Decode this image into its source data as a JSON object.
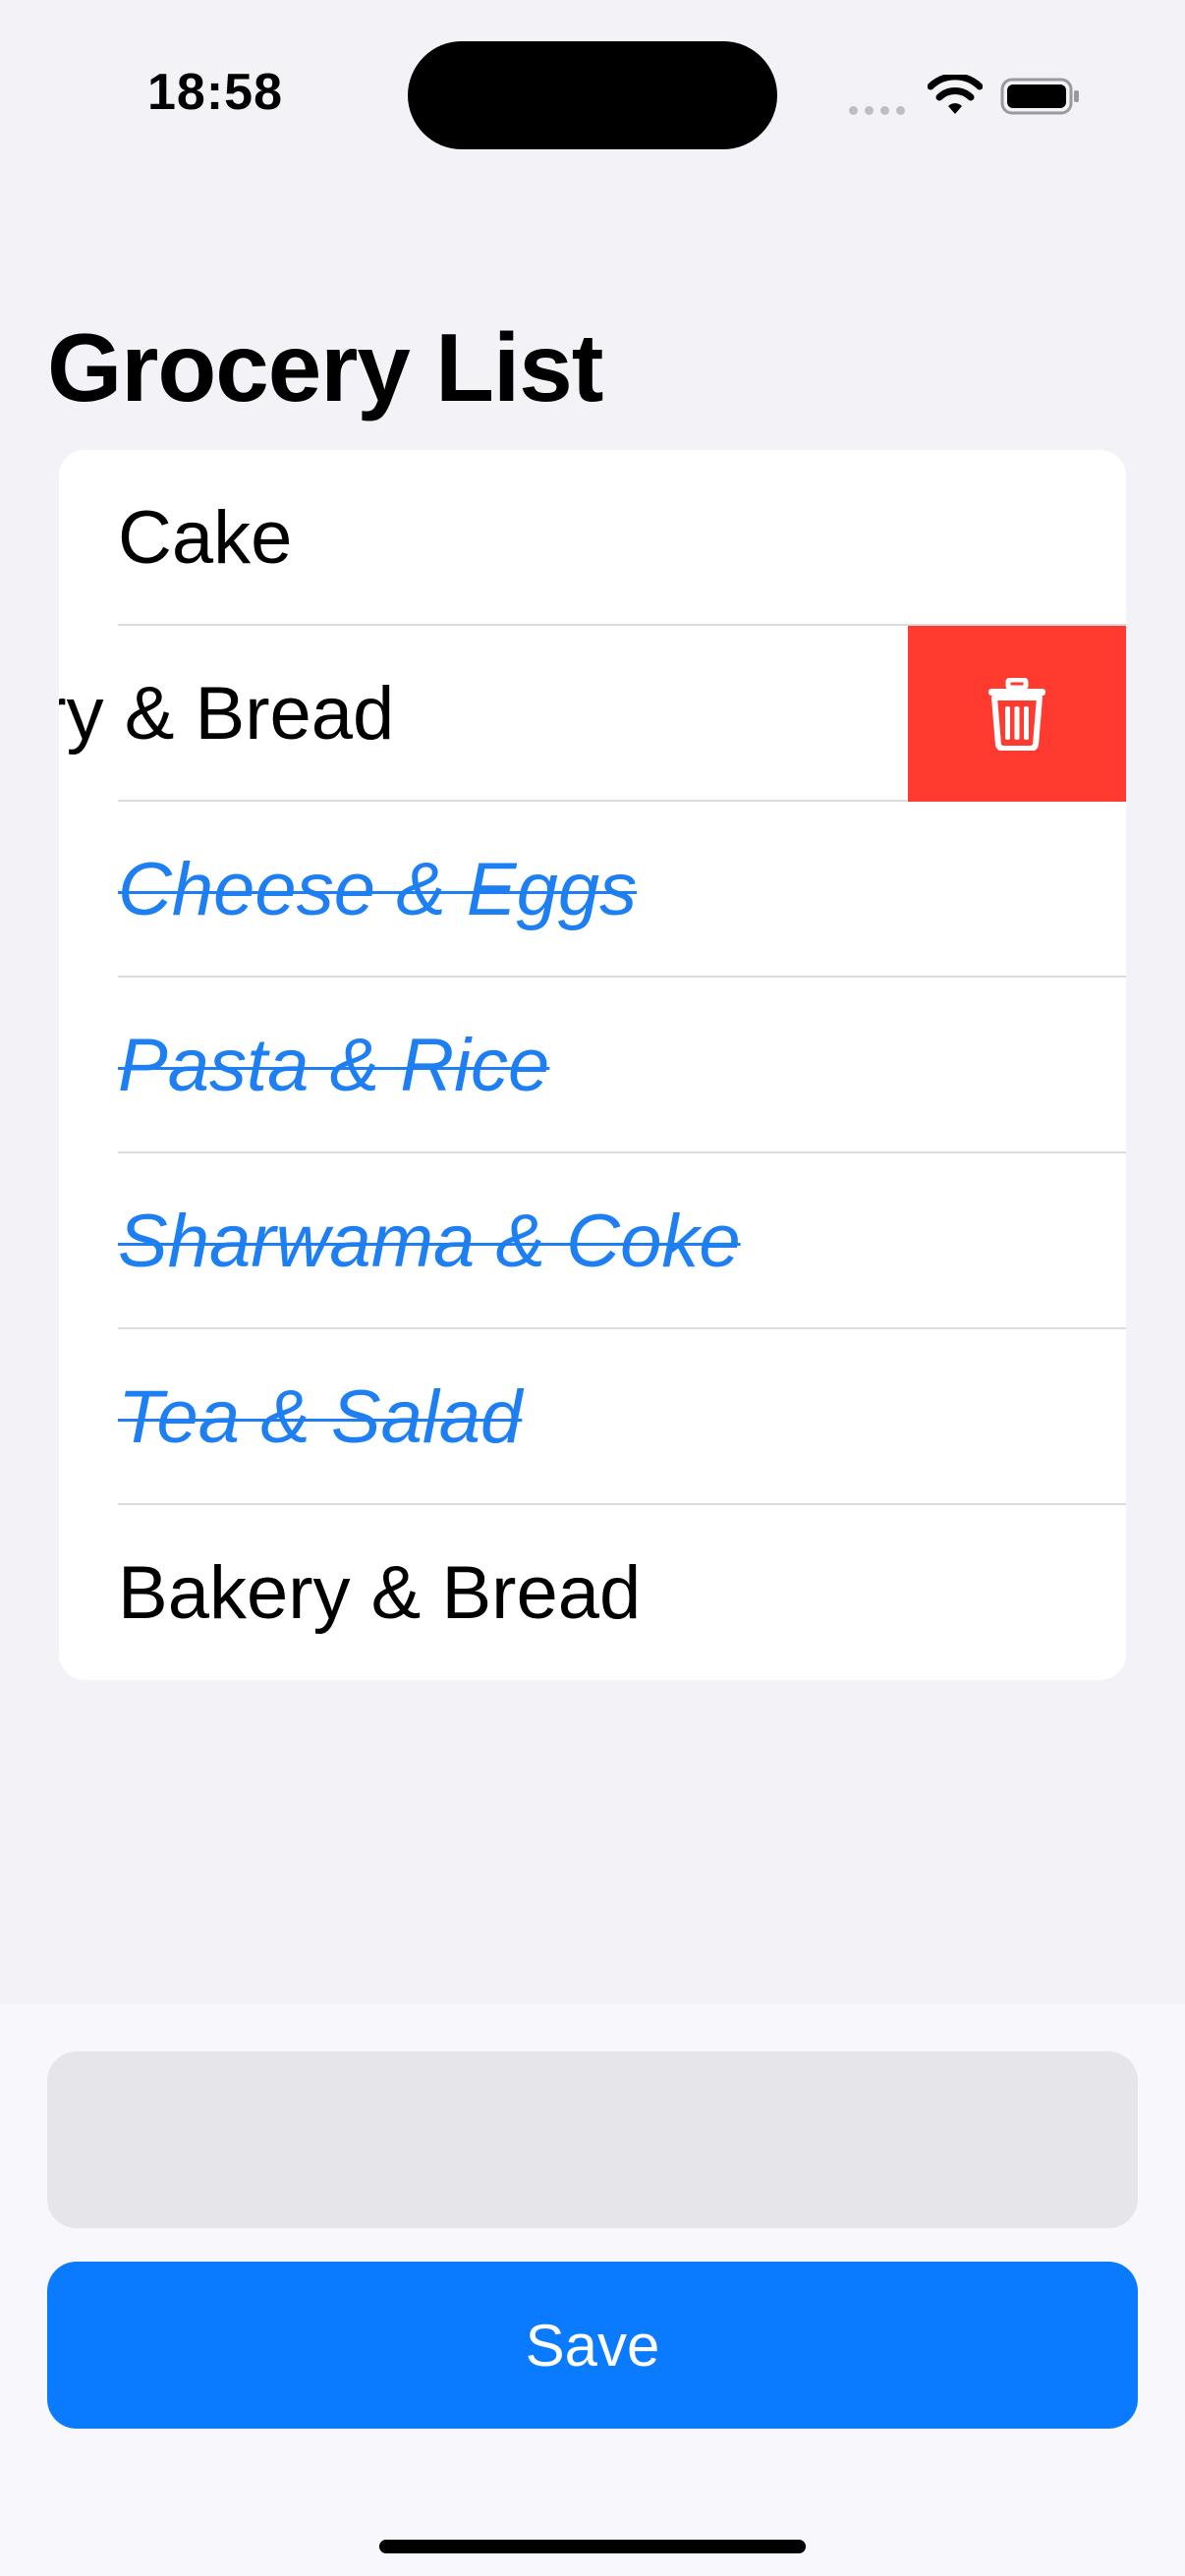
{
  "status_bar": {
    "time": "18:58",
    "icons": [
      "cellular-signal-icon",
      "wifi-icon",
      "battery-icon"
    ]
  },
  "page": {
    "title": "Grocery List"
  },
  "grocery_items": [
    {
      "label": "Cake",
      "completed": false
    },
    {
      "label": "Bakery & Bread",
      "completed": false,
      "visible_label": "ery & Bread",
      "swiped_to_delete": true
    },
    {
      "label": "Cheese & Eggs",
      "completed": true
    },
    {
      "label": "Pasta & Rice",
      "completed": true
    },
    {
      "label": "Sharwama & Coke",
      "completed": true
    },
    {
      "label": "Tea & Salad",
      "completed": true
    },
    {
      "label": "Bakery & Bread",
      "completed": false
    }
  ],
  "swipe_action": {
    "icon": "trash-icon",
    "color": "#FF3B30"
  },
  "new_item_input": {
    "value": "",
    "placeholder": ""
  },
  "save_button": {
    "label": "Save"
  },
  "colors": {
    "background": "#F2F2F7",
    "accent": "#0A7AFF",
    "completed_text": "#1E7FF3",
    "destructive": "#FF3B30"
  }
}
